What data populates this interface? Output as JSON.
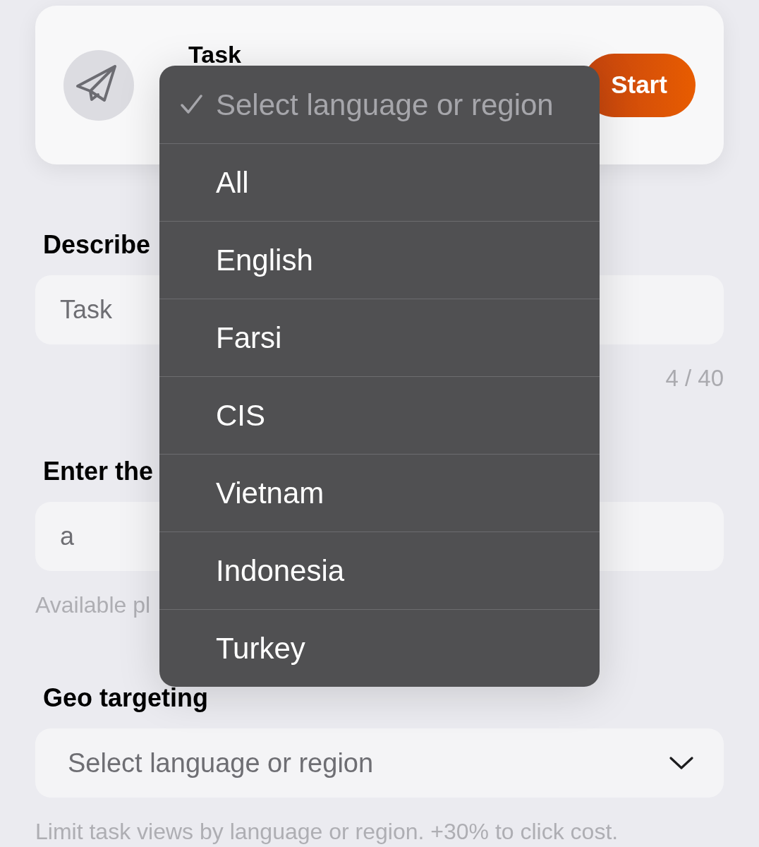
{
  "task_card": {
    "title": "Task",
    "button": "Start"
  },
  "sections": [
    {
      "label": "Describe",
      "field": {
        "kind": "text",
        "value": "Task"
      },
      "counter": "4 / 40"
    },
    {
      "label": "Enter the",
      "field": {
        "kind": "text",
        "value": "a"
      },
      "hint": "Available pl"
    },
    {
      "label": "Geo targeting",
      "field": {
        "kind": "select",
        "value": "Select language or region"
      },
      "hint": "Limit task views by language or region. +30% to click cost."
    }
  ],
  "dropdown_menu": {
    "options": [
      {
        "label": "Select language or region",
        "selected": true,
        "disabled": true
      },
      {
        "label": "All",
        "selected": false,
        "disabled": false
      },
      {
        "label": "English",
        "selected": false,
        "disabled": false
      },
      {
        "label": "Farsi",
        "selected": false,
        "disabled": false
      },
      {
        "label": "CIS",
        "selected": false,
        "disabled": false
      },
      {
        "label": "Vietnam",
        "selected": false,
        "disabled": false
      },
      {
        "label": "Indonesia",
        "selected": false,
        "disabled": false
      },
      {
        "label": "Turkey",
        "selected": false,
        "disabled": false
      }
    ]
  }
}
